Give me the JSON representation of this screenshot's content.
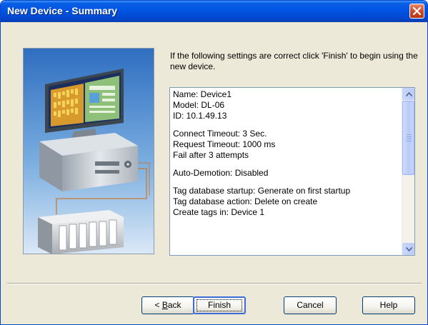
{
  "window": {
    "title": "New Device - Summary"
  },
  "intro": "If the following settings are correct click 'Finish' to begin using the new device.",
  "summary": {
    "groups": [
      [
        "Name: Device1",
        "Model: DL-06",
        "ID: 10.1.49.13"
      ],
      [
        "Connect Timeout: 3 Sec.",
        "Request Timeout: 1000 ms",
        "Fail after 3 attempts"
      ],
      [
        "Auto-Demotion: Disabled"
      ],
      [
        "Tag database startup: Generate on first startup",
        "Tag database action: Delete on create",
        "Create tags in: Device 1"
      ]
    ]
  },
  "buttons": {
    "back": {
      "prefix": "< ",
      "mnemonic": "B",
      "rest": "ack"
    },
    "finish": "Finish",
    "cancel": "Cancel",
    "help": "Help"
  },
  "icons": {
    "close": "close-x-icon",
    "scroll_up": "triangle-up-icon",
    "scroll_down": "triangle-down-icon"
  },
  "colors": {
    "titlebar": "#0054e3",
    "dialog_bg": "#ece9d8",
    "close_button": "#c9462a"
  }
}
